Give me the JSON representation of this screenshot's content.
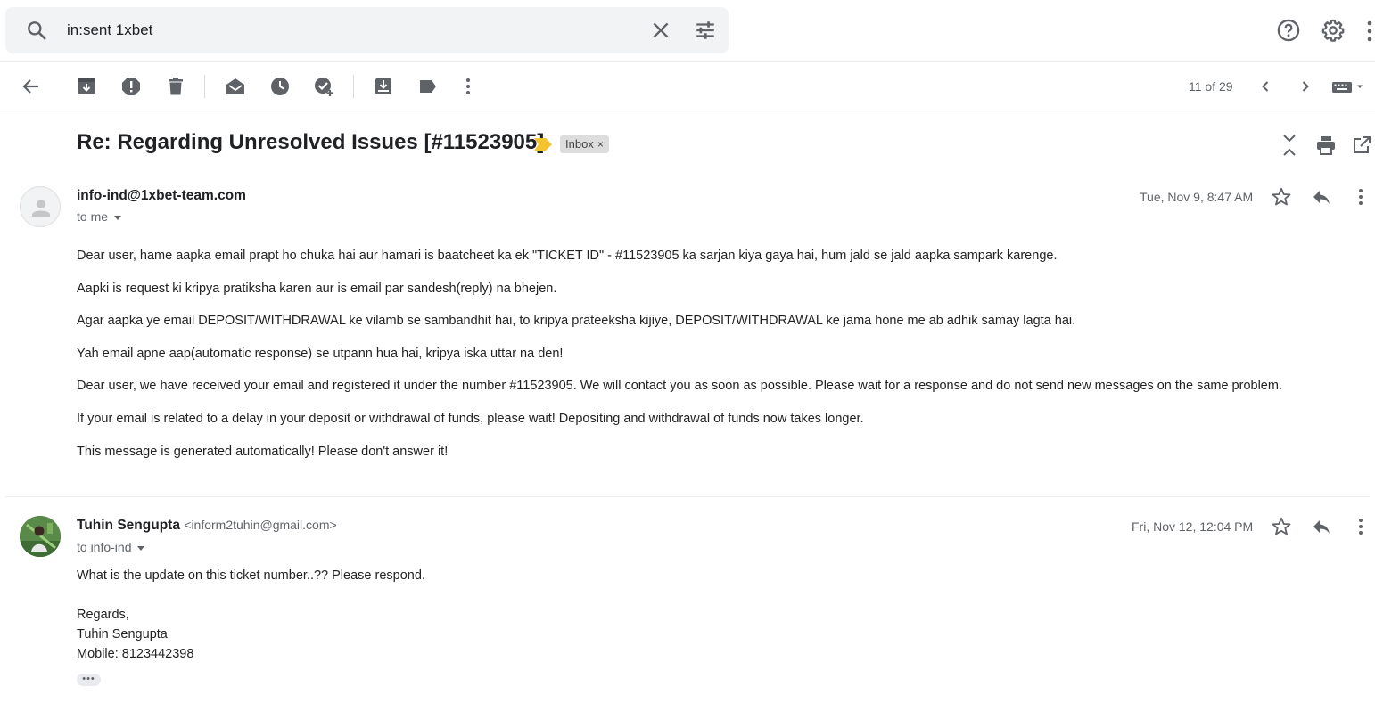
{
  "search": {
    "query": "in:sent 1xbet",
    "search_icon": "search-icon",
    "clear_icon": "close-icon",
    "options_icon": "tune-icon"
  },
  "top_right": {
    "help_icon": "help-icon",
    "settings_icon": "gear-icon",
    "more_icon": "more-vert-icon"
  },
  "toolbar": {
    "icons": [
      "back-arrow-icon",
      "archive-icon",
      "report-spam-icon",
      "delete-icon",
      "mark-unread-icon",
      "snooze-icon",
      "add-task-icon",
      "move-to-icon",
      "label-icon",
      "more-vert-icon"
    ],
    "pager": "11 of 29",
    "nav_icons": [
      "chevron-left-icon",
      "chevron-right-icon",
      "keyboard-icon"
    ]
  },
  "thread": {
    "subject": "Re: Regarding Unresolved Issues [#11523905]",
    "label": "Inbox",
    "label_close": "×",
    "header_icons": [
      "collapse-all-icon",
      "print-icon",
      "open-new-window-icon"
    ],
    "importance_color": "#f4c430"
  },
  "messages": [
    {
      "sender": "info-ind@1xbet-team.com",
      "sender_email": "",
      "to": "to me",
      "date": "Tue, Nov 9, 8:47 AM",
      "body": [
        "Dear user, hame aapka email prapt ho chuka hai aur hamari is baatcheet ka ek \"TICKET ID\" - #11523905 ka sarjan kiya gaya hai, hum jald se jald aapka sampark karenge.",
        "Aapki is request ki kripya pratiksha karen aur is email par sandesh(reply) na bhejen.",
        "Agar aapka ye email DEPOSIT/WITHDRAWAL ke vilamb se sambandhit hai, to kripya prateeksha kijiye, DEPOSIT/WITHDRAWAL ke jama hone me ab adhik samay lagta hai.",
        "Yah email apne aap(automatic response) se utpann hua hai, kripya iska uttar na den!",
        "Dear user, we have received your email and registered it under the number #11523905. We will contact you as soon as possible. Please wait for a response and do not send new messages on the same problem.",
        "If your email is related to a delay in your deposit or withdrawal of funds, please wait! Depositing and withdrawal of funds now takes longer.",
        "This message is generated automatically! Please don't answer it!"
      ]
    },
    {
      "sender": "Tuhin Sengupta",
      "sender_email": "<inform2tuhin@gmail.com>",
      "to": "to info-ind",
      "date": "Fri, Nov 12, 12:04 PM",
      "body": [
        "What is the update on this ticket number..?? Please respond.",
        "",
        "Regards,",
        "Tuhin Sengupta",
        "Mobile: 8123442398"
      ],
      "trimmed_indicator": "•••"
    }
  ],
  "colors": {
    "icon_gray": "#5f6368",
    "search_bg": "#f1f3f4",
    "label_bg": "#dddddd"
  }
}
